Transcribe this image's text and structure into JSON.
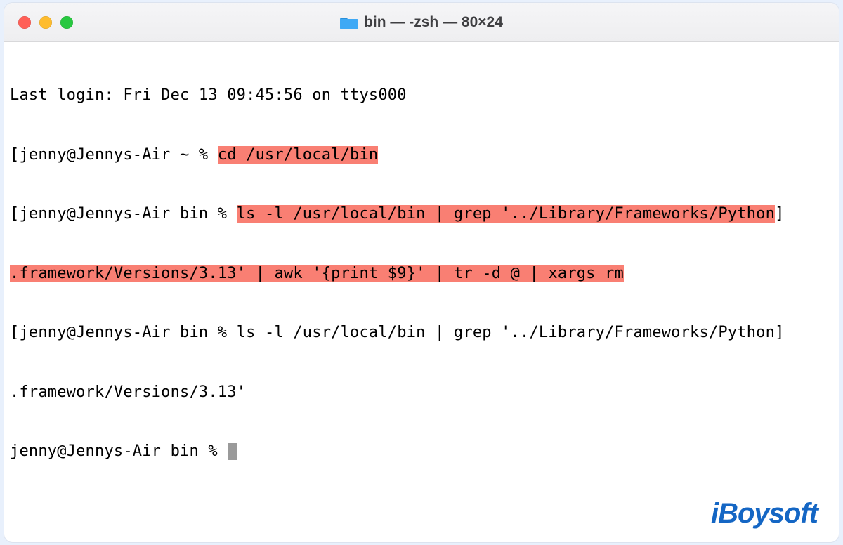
{
  "window": {
    "title": "bin — -zsh — 80×24"
  },
  "terminal": {
    "login_line": "Last login: Fri Dec 13 09:45:56 on ttys000",
    "prompt1_prefix": "[jenny@Jennys-Air ~ % ",
    "cmd1": "cd /usr/local/bin",
    "prompt2_prefix": "[jenny@Jennys-Air bin % ",
    "cmd2_part_a": "ls -l /usr/local/bin | grep '../Library/Frameworks/Python",
    "cmd2_bracket": "]",
    "cmd2_part_b": ".framework/Versions/3.13' | awk '{print $9}' | tr -d @ | xargs rm",
    "prompt3_prefix": "[jenny@Jennys-Air bin % ",
    "cmd3_part_a": "ls -l /usr/local/bin | grep '../Library/Frameworks/Python",
    "cmd3_bracket": "]",
    "cmd3_part_b": ".framework/Versions/3.13'",
    "prompt4": "jenny@Jennys-Air bin % "
  },
  "brand": "iBoysoft"
}
